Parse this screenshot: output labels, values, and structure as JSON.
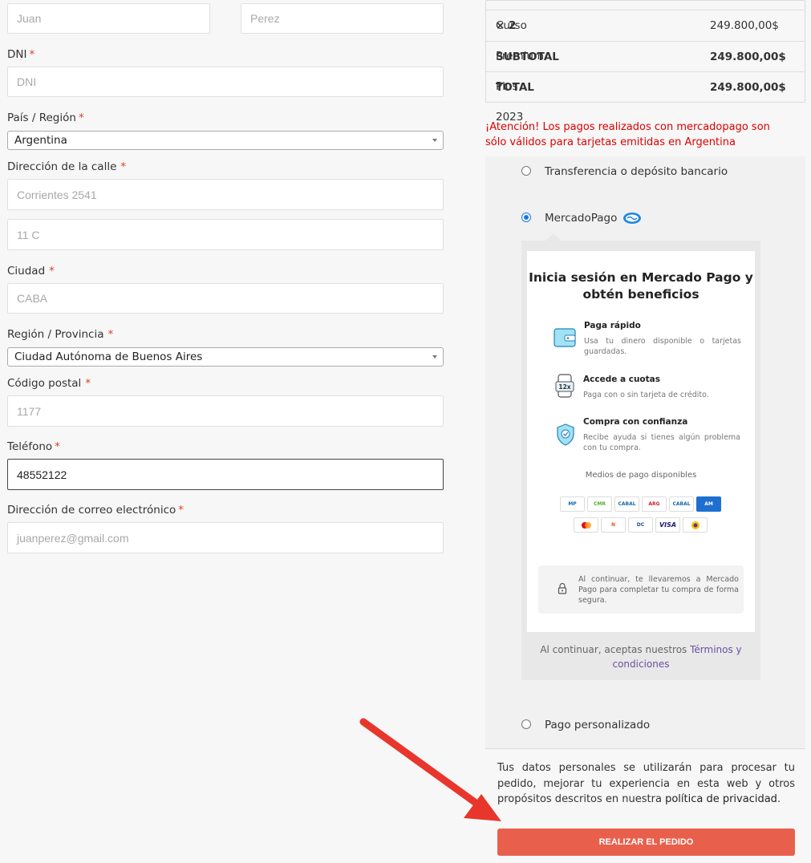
{
  "form": {
    "first_name": {
      "placeholder": "Juan"
    },
    "last_name": {
      "placeholder": "Perez"
    },
    "dni": {
      "label": "DNI",
      "placeholder": "DNI"
    },
    "country": {
      "label": "País / Región",
      "value": "Argentina"
    },
    "street": {
      "label": "Dirección de la calle",
      "placeholder1": "Corrientes 2541",
      "placeholder2": "11 C"
    },
    "city": {
      "label": "Ciudad",
      "placeholder": "CABA"
    },
    "province": {
      "label": "Región / Provincia",
      "value": "Ciudad Autónoma de Buenos Aires"
    },
    "postal": {
      "label": "Código postal",
      "placeholder": "1177"
    },
    "phone": {
      "label": "Teléfono",
      "value": "48552122"
    },
    "email": {
      "label": "Dirección de correo electrónico",
      "placeholder": "juanperez@gmail.com"
    },
    "required_mark": "*"
  },
  "order": {
    "item_name": "Curso Premium Plus 2023",
    "item_qty": "× 2",
    "item_price": "249.800,00$",
    "subtotal_label": "SUBTOTAL",
    "subtotal_value": "249.800,00$",
    "total_label": "TOTAL",
    "total_value": "249.800,00$"
  },
  "warning": "¡Atención! Los pagos realizados con mercadopago son sólo válidos para tarjetas emitidas en Argentina",
  "payment": {
    "bank": "Transferencia o depósito bancario",
    "mercadopago": "MercadoPago",
    "custom": "Pago personalizado"
  },
  "mp": {
    "title": "Inicia sesión en Mercado Pago y obtén beneficios",
    "b1_title": "Paga rápido",
    "b1_desc": "Usa tu dinero disponible o tarjetas guardadas.",
    "b2_title": "Accede a cuotas",
    "b2_desc": "Paga con o sin tarjeta de crédito.",
    "b2_badge": "12x",
    "b3_title": "Compra con confianza",
    "b3_desc": "Recibe ayuda si tienes algún problema con tu compra.",
    "methods_title": "Medios de pago disponibles",
    "methods": [
      "MERCADO PAGO",
      "CMR",
      "CABAL",
      "ARGENCARD",
      "CABAL",
      "AMEX",
      "MASTERCARD",
      "NARANJA",
      "DINERS",
      "VISA",
      "CENCOSUD"
    ],
    "lock_text": "Al continuar, te llevaremos a Mercado Pago para completar tu compra de forma segura.",
    "terms_prefix": "Al continuar, aceptas nuestros ",
    "terms_link": "Términos y condiciones"
  },
  "privacy": {
    "text": "Tus datos personales se utilizarán para procesar tu pedido, mejorar tu experiencia en esta web y otros propósitos descritos en nuestra ",
    "link": "política de privacidad",
    "end": "."
  },
  "submit_label": "REALIZAR EL PEDIDO",
  "colors": {
    "accent": "#e8604c",
    "required": "#e2401c",
    "radio": "#1d73e8",
    "warning": "#dd0000"
  }
}
